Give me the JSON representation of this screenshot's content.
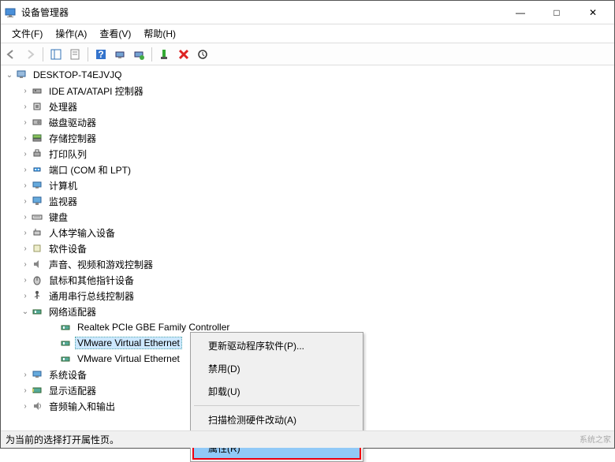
{
  "window": {
    "title": "设备管理器",
    "minimize": "—",
    "maximize": "□",
    "close": "✕"
  },
  "menu": {
    "file": "文件(F)",
    "action": "操作(A)",
    "view": "查看(V)",
    "help": "帮助(H)"
  },
  "tree": {
    "root": "DESKTOP-T4EJVJQ",
    "c0": "IDE ATA/ATAPI 控制器",
    "c1": "处理器",
    "c2": "磁盘驱动器",
    "c3": "存储控制器",
    "c4": "打印队列",
    "c5": "端口 (COM 和 LPT)",
    "c6": "计算机",
    "c7": "监视器",
    "c8": "键盘",
    "c9": "人体学输入设备",
    "c10": "软件设备",
    "c11": "声音、视频和游戏控制器",
    "c12": "鼠标和其他指针设备",
    "c13": "通用串行总线控制器",
    "c14": "网络适配器",
    "c14_0": "Realtek PCIe GBE Family Controller",
    "c14_1": "VMware Virtual Ethernet",
    "c14_2": "VMware Virtual Ethernet",
    "c15": "系统设备",
    "c16": "显示适配器",
    "c17": "音频输入和输出"
  },
  "context": {
    "updateDriver": "更新驱动程序软件(P)...",
    "disable": "禁用(D)",
    "uninstall": "卸载(U)",
    "scan": "扫描检测硬件改动(A)",
    "properties": "属性(R)"
  },
  "statusbar": {
    "text": "为当前的选择打开属性页。"
  },
  "watermark": "系统之家"
}
